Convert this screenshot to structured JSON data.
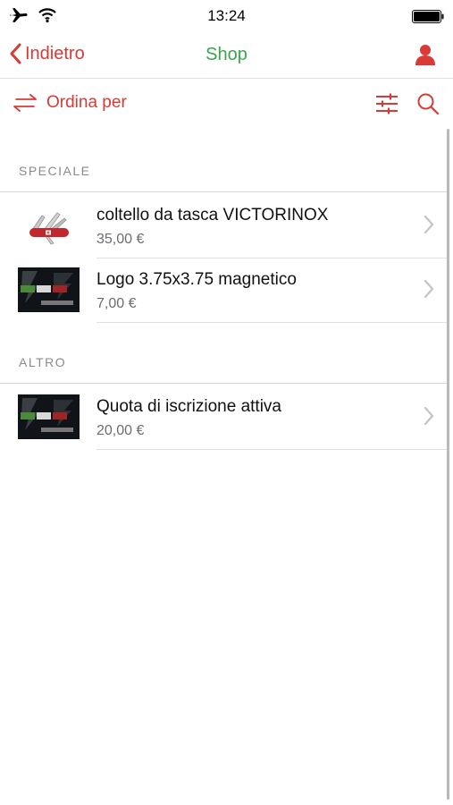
{
  "status": {
    "time": "13:24"
  },
  "nav": {
    "back_label": "Indietro",
    "title": "Shop"
  },
  "toolbar": {
    "sort_label": "Ordina per"
  },
  "sections": [
    {
      "header": "SPECIALE",
      "items": [
        {
          "title": "coltello da tasca VICTORINOX",
          "price": "35,00 €",
          "thumb": "pocket-knife"
        },
        {
          "title": "Logo 3.75x3.75 magnetico",
          "price": "7,00 €",
          "thumb": "logo-image"
        }
      ]
    },
    {
      "header": "ALTRO",
      "items": [
        {
          "title": "Quota di iscrizione attiva",
          "price": "20,00 €",
          "thumb": "logo-image"
        }
      ]
    }
  ],
  "colors": {
    "accent": "#d93a35",
    "title": "#3aa64a",
    "secondary": "#6d6d72"
  }
}
